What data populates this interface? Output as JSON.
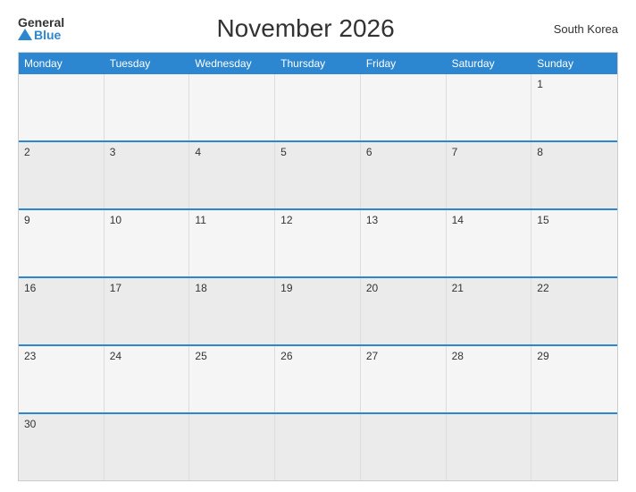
{
  "header": {
    "logo_general": "General",
    "logo_blue": "Blue",
    "title": "November 2026",
    "country": "South Korea"
  },
  "calendar": {
    "days_of_week": [
      "Monday",
      "Tuesday",
      "Wednesday",
      "Thursday",
      "Friday",
      "Saturday",
      "Sunday"
    ],
    "weeks": [
      [
        {
          "day": "",
          "empty": true
        },
        {
          "day": "",
          "empty": true
        },
        {
          "day": "",
          "empty": true
        },
        {
          "day": "",
          "empty": true
        },
        {
          "day": "",
          "empty": true
        },
        {
          "day": "",
          "empty": true
        },
        {
          "day": "1",
          "empty": false
        }
      ],
      [
        {
          "day": "2",
          "empty": false
        },
        {
          "day": "3",
          "empty": false
        },
        {
          "day": "4",
          "empty": false
        },
        {
          "day": "5",
          "empty": false
        },
        {
          "day": "6",
          "empty": false
        },
        {
          "day": "7",
          "empty": false
        },
        {
          "day": "8",
          "empty": false
        }
      ],
      [
        {
          "day": "9",
          "empty": false
        },
        {
          "day": "10",
          "empty": false
        },
        {
          "day": "11",
          "empty": false
        },
        {
          "day": "12",
          "empty": false
        },
        {
          "day": "13",
          "empty": false
        },
        {
          "day": "14",
          "empty": false
        },
        {
          "day": "15",
          "empty": false
        }
      ],
      [
        {
          "day": "16",
          "empty": false
        },
        {
          "day": "17",
          "empty": false
        },
        {
          "day": "18",
          "empty": false
        },
        {
          "day": "19",
          "empty": false
        },
        {
          "day": "20",
          "empty": false
        },
        {
          "day": "21",
          "empty": false
        },
        {
          "day": "22",
          "empty": false
        }
      ],
      [
        {
          "day": "23",
          "empty": false
        },
        {
          "day": "24",
          "empty": false
        },
        {
          "day": "25",
          "empty": false
        },
        {
          "day": "26",
          "empty": false
        },
        {
          "day": "27",
          "empty": false
        },
        {
          "day": "28",
          "empty": false
        },
        {
          "day": "29",
          "empty": false
        }
      ],
      [
        {
          "day": "30",
          "empty": false
        },
        {
          "day": "",
          "empty": true
        },
        {
          "day": "",
          "empty": true
        },
        {
          "day": "",
          "empty": true
        },
        {
          "day": "",
          "empty": true
        },
        {
          "day": "",
          "empty": true
        },
        {
          "day": "",
          "empty": true
        }
      ]
    ]
  }
}
